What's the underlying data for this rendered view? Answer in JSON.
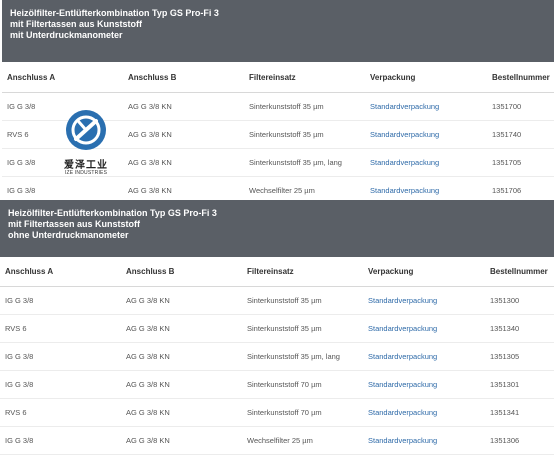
{
  "section1": {
    "title_lines": [
      "Heizölfilter-Entlüfterkombination Typ GS Pro-Fi 3",
      "mit Filtertassen aus Kunststoff",
      "mit Unterdruckmanometer"
    ],
    "headers": [
      "Anschluss A",
      "Anschluss B",
      "Filtereinsatz",
      "Verpackung",
      "Bestellnummer"
    ],
    "rows": [
      [
        "IG G 3/8",
        "AG G 3/8 KN",
        "Sinterkunststoff 35 µm",
        "Standardverpackung",
        "1351700"
      ],
      [
        "RVS 6",
        "AG G 3/8 KN",
        "Sinterkunststoff 35 µm",
        "Standardverpackung",
        "1351740"
      ],
      [
        "IG G 3/8",
        "AG G 3/8 KN",
        "Sinterkunststoff 35 µm, lang",
        "Standardverpackung",
        "1351705"
      ],
      [
        "IG G 3/8",
        "AG G 3/8 KN",
        "Wechselfilter 25 µm",
        "Standardverpackung",
        "1351706"
      ]
    ]
  },
  "section2": {
    "title_lines": [
      "Heizölfilter-Entlüfterkombination Typ GS Pro-Fi 3",
      "mit Filtertassen aus Kunststoff",
      "ohne Unterdruckmanometer"
    ],
    "headers": [
      "Anschluss A",
      "Anschluss B",
      "Filtereinsatz",
      "Verpackung",
      "Bestellnummer"
    ],
    "rows": [
      [
        "IG G 3/8",
        "AG G 3/8 KN",
        "Sinterkunststoff 35 µm",
        "Standardverpackung",
        "1351300"
      ],
      [
        "RVS 6",
        "AG G 3/8 KN",
        "Sinterkunststoff 35 µm",
        "Standardverpackung",
        "1351340"
      ],
      [
        "IG G 3/8",
        "AG G 3/8 KN",
        "Sinterkunststoff 35 µm, lang",
        "Standardverpackung",
        "1351305"
      ],
      [
        "IG G 3/8",
        "AG G 3/8 KN",
        "Sinterkunststoff 70 µm",
        "Standardverpackung",
        "1351301"
      ],
      [
        "RVS 6",
        "AG G 3/8 KN",
        "Sinterkunststoff 70 µm",
        "Standardverpackung",
        "1351341"
      ],
      [
        "IG G 3/8",
        "AG G 3/8 KN",
        "Wechselfilter 25 µm",
        "Standardverpackung",
        "1351306"
      ]
    ]
  },
  "watermark": {
    "name_cn": "爱泽工业",
    "name_en": "IZE INDUSTRIES"
  },
  "colors": {
    "banner": "#5a5f66",
    "link": "#2e6aa8",
    "logo_blue": "#2a6fb0"
  }
}
